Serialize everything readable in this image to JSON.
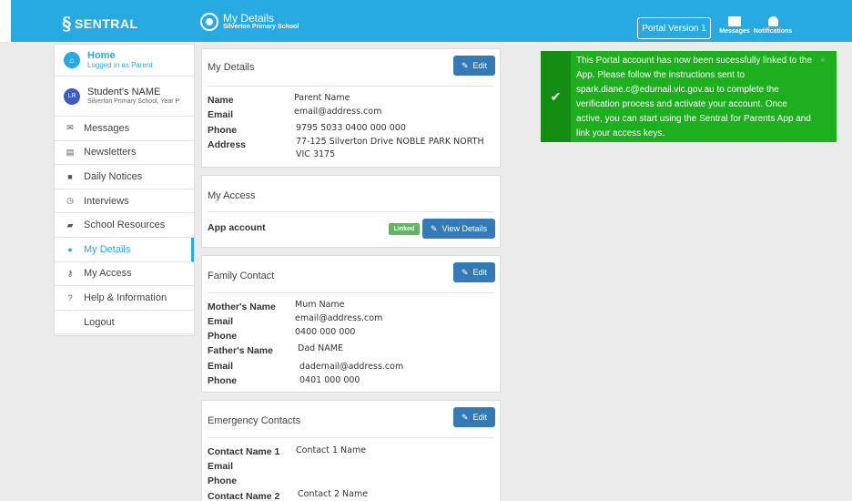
{
  "brand": {
    "name": "SENTRAL"
  },
  "header": {
    "title": "My Details",
    "subtitle": "Silverton Primary School",
    "portal_button": "Portal Version 1",
    "messages_label": "Messages",
    "notifications_label": "Notifications"
  },
  "sidebar": {
    "home_title": "Home",
    "home_sub_prefix": "Logged in as",
    "home_sub_role": "Parent",
    "student_initials": "LR",
    "student_name": "Student's NAME",
    "student_school": "Silverton Primary School, Year P",
    "items": [
      {
        "label": "Messages",
        "icon": "envelope-icon"
      },
      {
        "label": "Newsletters",
        "icon": "newspaper-icon"
      },
      {
        "label": "Daily Notices",
        "icon": "notice-icon"
      },
      {
        "label": "Interviews",
        "icon": "clock-icon"
      },
      {
        "label": "School Resources",
        "icon": "folder-icon"
      },
      {
        "label": "My Details",
        "icon": "user-icon",
        "active": true
      },
      {
        "label": "My Access",
        "icon": "key-icon"
      },
      {
        "label": "Help & Information",
        "icon": "question-icon"
      },
      {
        "label": "Logout",
        "icon": ""
      }
    ]
  },
  "my_details": {
    "heading": "My Details",
    "edit_label": "Edit",
    "fields": [
      {
        "label": "Name",
        "value": "Parent Name"
      },
      {
        "label": "Email",
        "value": "email@address.com"
      },
      {
        "label": "Phone",
        "value": "9795 5033 0400 000 000"
      },
      {
        "label": "Address",
        "value": "77-125 Silverton Drive NOBLE PARK NORTH",
        "value2": "VIC 3175"
      }
    ]
  },
  "my_access": {
    "heading": "My Access",
    "row_label": "App account",
    "badge": "Linked",
    "button": "View Details"
  },
  "family_contact": {
    "heading": "Family Contact",
    "edit_label": "Edit",
    "fields": [
      {
        "label": "Mother's Name",
        "value": "Mum Name"
      },
      {
        "label": "Email",
        "value": "email@address.com"
      },
      {
        "label": "Phone",
        "value": "0400 000 000"
      },
      {
        "label": "Father's Name",
        "value": "Dad NAME"
      },
      {
        "label": "Email",
        "value": "dademail@address.com"
      },
      {
        "label": "Phone",
        "value": "0401 000 000"
      }
    ]
  },
  "emergency_contacts": {
    "heading": "Emergency Contacts",
    "edit_label": "Edit",
    "fields": [
      {
        "label": "Contact Name 1",
        "value": "Contact 1 Name"
      },
      {
        "label": "Email",
        "value": ""
      },
      {
        "label": "Phone",
        "value": ""
      },
      {
        "label": "Contact Name 2",
        "value": "Contact 2 Name"
      }
    ]
  },
  "alert": {
    "message": "This Portal account has now been sucessfully linked to the App. Please follow the instructions sent to spark.diane.c@edumail.vic.gov.au to complete the verification process and activate your account. Once active, you can start using the Sentral for Parents App and link your access keys."
  },
  "colors": {
    "topbar": "#27a9e1",
    "primary_button": "#337ab7",
    "alert_bg": "#1eaf1e",
    "alert_side": "#138e13",
    "badge": "#5cb85c"
  }
}
